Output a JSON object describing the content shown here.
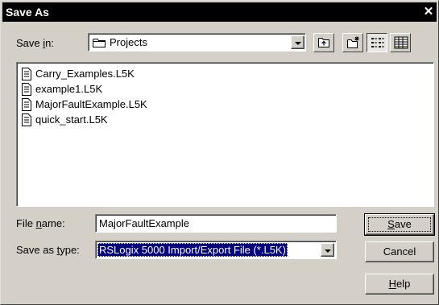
{
  "dialog": {
    "title": "Save As",
    "close_glyph": "✕"
  },
  "save_in": {
    "label_pre": "Save ",
    "label_accel": "i",
    "label_post": "n:",
    "value": "Projects",
    "icon": "folder-icon"
  },
  "toolbar": {
    "buttons": [
      {
        "name": "up-one-level-button",
        "icon": "up-folder-icon"
      },
      {
        "name": "create-new-folder-button",
        "icon": "new-folder-icon"
      },
      {
        "name": "list-view-button",
        "icon": "list-view-icon",
        "pressed": true
      },
      {
        "name": "details-view-button",
        "icon": "details-view-icon",
        "pressed": false
      }
    ]
  },
  "files": [
    {
      "name": "Carry_Examples.L5K"
    },
    {
      "name": "example1.L5K"
    },
    {
      "name": "MajorFaultExample.L5K"
    },
    {
      "name": "quick_start.L5K"
    }
  ],
  "file_name": {
    "label_pre": "File ",
    "label_accel": "n",
    "label_post": "ame:",
    "value": "MajorFaultExample"
  },
  "save_as_type": {
    "label_pre": "Save as ",
    "label_accel": "t",
    "label_post": "ype:",
    "value": "RSLogix 5000 Import/Export File (*.L5K)"
  },
  "buttons": {
    "save_accel": "S",
    "save_rest": "ave",
    "cancel": "Cancel",
    "help_accel": "H",
    "help_rest": "elp"
  },
  "colors": {
    "face": "#d4d0c8",
    "title_bar": "#000000",
    "selection": "#000080"
  }
}
